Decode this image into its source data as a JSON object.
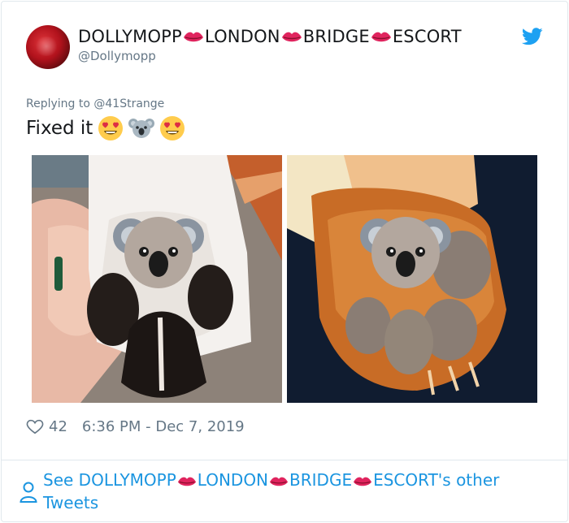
{
  "tweet": {
    "display_name_parts": [
      "DOLLYMOPP",
      "LONDON",
      "BRIDGE",
      "ESCORT"
    ],
    "handle": "@Dollymopp",
    "replying_to": "Replying to @41Strange",
    "text": "Fixed it",
    "text_emojis": [
      "heart-eyes-emoji",
      "koala-emoji",
      "heart-eyes-emoji"
    ],
    "likes": "42",
    "timestamp": "6:36 PM - Dec 7, 2019"
  },
  "footer": {
    "prefix": "See ",
    "name_parts": [
      "DOLLYMOPP",
      "LONDON",
      "BRIDGE",
      "ESCORT"
    ],
    "suffix": "'s other Tweets"
  },
  "colors": {
    "link": "#1b95e0",
    "muted": "#657786",
    "text": "#14171a",
    "lips": "#e0245e"
  },
  "icons": [
    "twitter-bird-icon",
    "heart-outline-icon",
    "person-icon",
    "kiss-mark-icon"
  ]
}
